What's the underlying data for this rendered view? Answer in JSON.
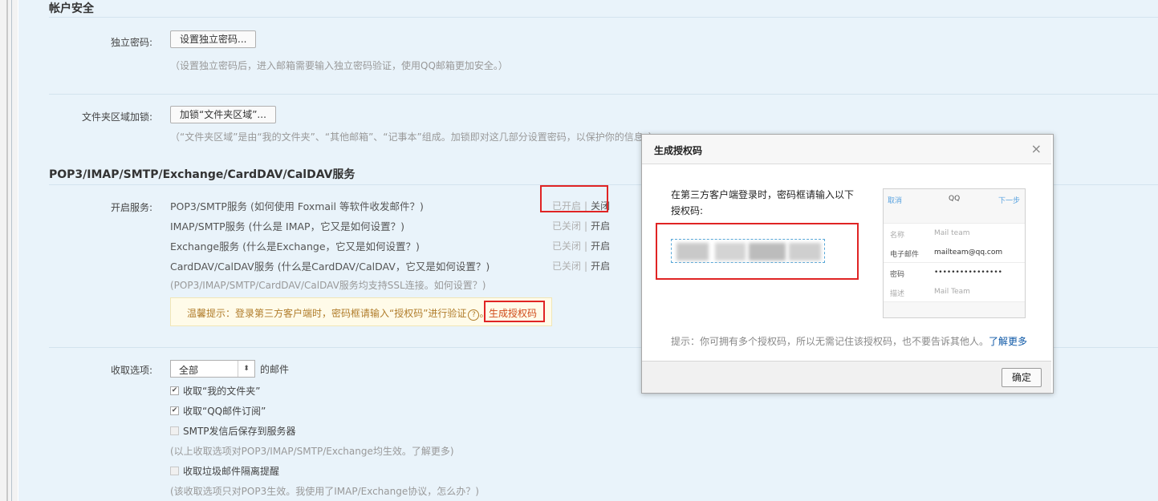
{
  "account_security": {
    "title": "帐户安全",
    "independent_password": {
      "label": "独立密码:",
      "button": "设置独立密码...",
      "hint": "（设置独立密码后，进入邮箱需要输入独立密码验证，使用QQ邮箱更加安全。）"
    },
    "folder_lock": {
      "label": "文件夹区域加锁:",
      "button": "加锁“文件夹区域”...",
      "hint": "（“文件夹区域”是由“我的文件夹”、“其他邮箱”、“记事本”组成。加锁即对这几部分设置密码，以保护你的信息。）"
    }
  },
  "services": {
    "title": "POP3/IMAP/SMTP/Exchange/CardDAV/CalDAV服务",
    "label": "开启服务:",
    "items": [
      {
        "name": "POP3/SMTP服务",
        "help": "(如何使用 Foxmail 等软件收发邮件？)",
        "state": "已开启",
        "action": "关闭"
      },
      {
        "name": "IMAP/SMTP服务",
        "help": "(什么是 IMAP，它又是如何设置？)",
        "state": "已关闭",
        "action": "开启"
      },
      {
        "name": "Exchange服务",
        "help": "(什么是Exchange，它又是如何设置？)",
        "state": "已关闭",
        "action": "开启"
      },
      {
        "name": "CardDAV/CalDAV服务",
        "help": "(什么是CardDAV/CalDAV，它又是如何设置？)",
        "state": "已关闭",
        "action": "开启"
      }
    ],
    "separator": "|",
    "ssl_hint": "(POP3/IMAP/SMTP/CardDAV/CalDAV服务均支持SSL连接。如何设置？)",
    "tip": "温馨提示：登录第三方客户端时，密码框请输入“授权码”进行验证",
    "tip_help_icon": "?",
    "tip_link": "生成授权码"
  },
  "receive": {
    "label": "收取选项:",
    "select_value": "全部",
    "select_arrow": "⬍",
    "suffix": "的邮件",
    "options": [
      {
        "label": "收取“我的文件夹”",
        "checked": true
      },
      {
        "label": "收取“QQ邮件订阅”",
        "checked": true
      },
      {
        "label": "SMTP发信后保存到服务器",
        "checked": false
      }
    ],
    "hint1": "(以上收取选项对POP3/IMAP/SMTP/Exchange均生效。了解更多)",
    "spam_option": {
      "label": "收取垃圾邮件隔离提醒",
      "checked": false
    },
    "hint2": "(该收取选项只对POP3生效。我使用了IMAP/Exchange协议，怎么办？)"
  },
  "dialog": {
    "title": "生成授权码",
    "close_icon": "close-icon",
    "close_glyph": "×",
    "intro_line1": "在第三方客户端登录时，密码框请输入以下",
    "intro_line2": "授权码:",
    "phone": {
      "cancel": "取消",
      "title": "QQ",
      "next": "下一步",
      "rows": [
        {
          "key": "名称",
          "value": "Mail team"
        },
        {
          "key": "电子邮件",
          "value": "mailteam@qq.com"
        },
        {
          "key": "密码",
          "value": "••••••••••••••••"
        },
        {
          "key": "描述",
          "value": "Mail Team"
        }
      ]
    },
    "footer_tip": "提示：你可拥有多个授权码，所以无需记住该授权码，也不要告诉其他人。",
    "learn_more": "了解更多",
    "ok_button": "确定"
  },
  "colors": {
    "page_bg": "#e9f3fa",
    "highlight": "#e02424",
    "link": "#0c57a6",
    "tip_text": "#b07c2a"
  }
}
